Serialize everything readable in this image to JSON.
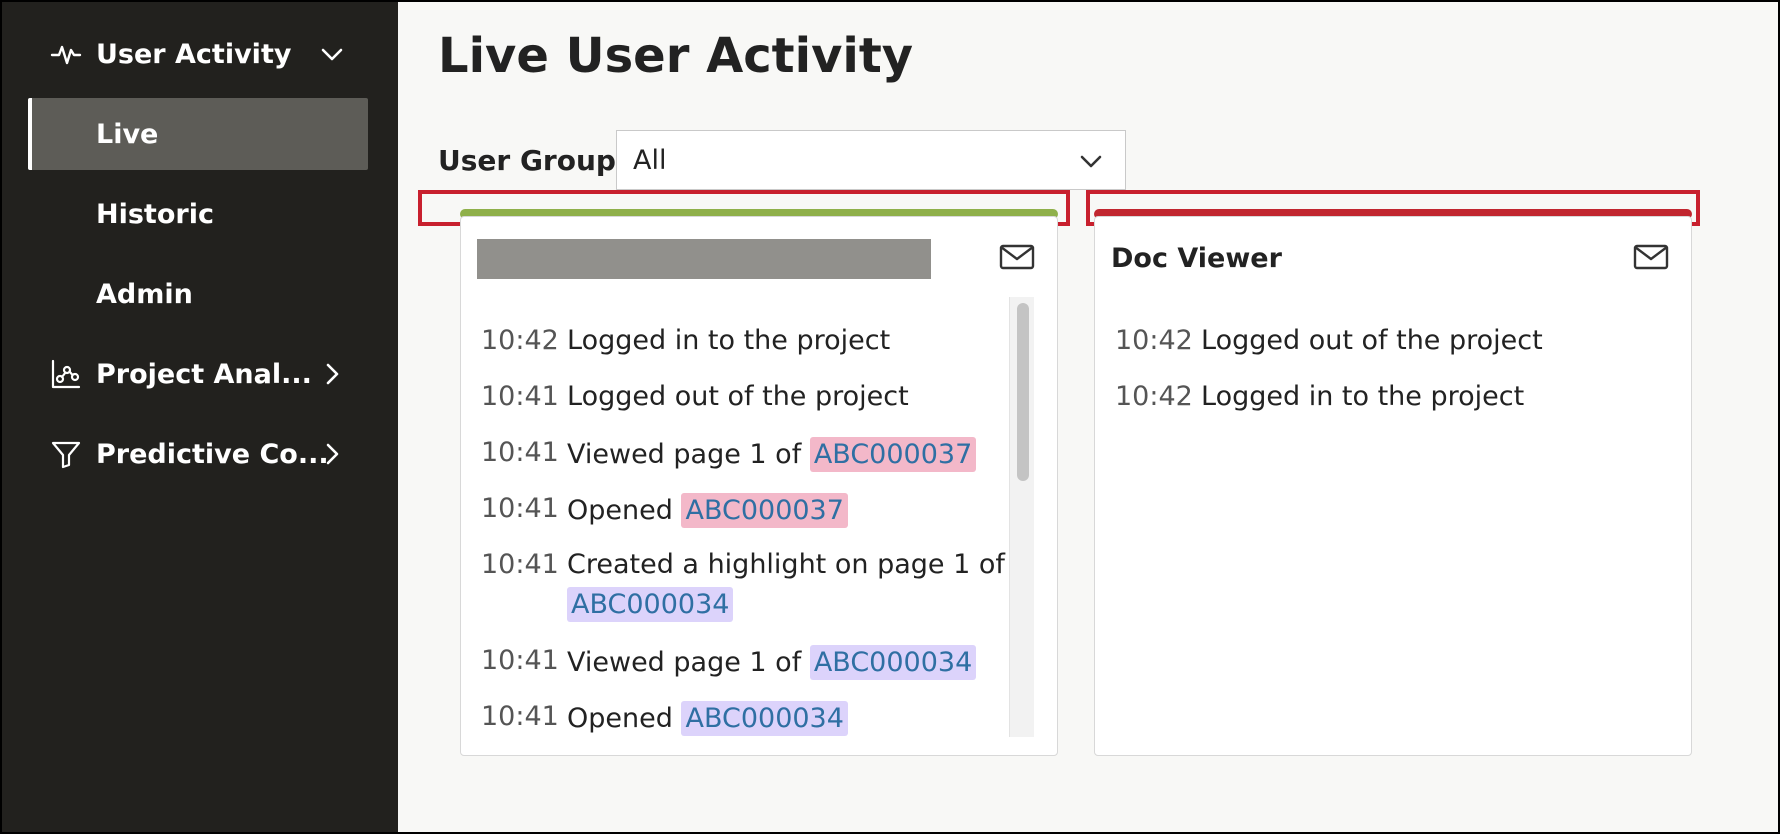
{
  "sidebar": {
    "user_activity": {
      "label": "User Activity",
      "icon": "activity-pulse-icon"
    },
    "sub_items": [
      {
        "label": "Live",
        "active": true
      },
      {
        "label": "Historic"
      },
      {
        "label": "Admin"
      }
    ],
    "project_analytics": {
      "label": "Project Anal...",
      "icon": "graph-nodes-icon"
    },
    "predictive_coding": {
      "label": "Predictive Co...",
      "icon": "filter-funnel-icon"
    }
  },
  "main": {
    "title": "Live User Activity",
    "user_group": {
      "label": "User Group:",
      "value": "All"
    },
    "colors": {
      "highlight_box": "#c8202e",
      "card1_status": "#8fb04a",
      "card2_status": "#c1262f",
      "doc_pink": "#f3b8c9",
      "doc_lavender": "#dcd3fb"
    },
    "cards": [
      {
        "title": "",
        "entries": [
          {
            "time": "10:42",
            "text": "Logged in to the project",
            "doc": ""
          },
          {
            "time": "10:41",
            "text": "Logged out of the project",
            "doc": ""
          },
          {
            "time": "10:41",
            "text": "Viewed page 1 of",
            "doc": "ABC000037"
          },
          {
            "time": "10:41",
            "text": "Opened",
            "doc": "ABC000037"
          },
          {
            "time": "10:41",
            "text": "Created a highlight on page 1 of",
            "doc": "ABC000034"
          },
          {
            "time": "10:41",
            "text": "Viewed page 1 of",
            "doc": "ABC000034"
          },
          {
            "time": "10:41",
            "text": "Opened",
            "doc": "ABC000034"
          }
        ]
      },
      {
        "title": "Doc Viewer",
        "entries": [
          {
            "time": "10:42",
            "text": "Logged out of the project"
          },
          {
            "time": "10:42",
            "text": "Logged in to the project"
          }
        ]
      }
    ]
  }
}
